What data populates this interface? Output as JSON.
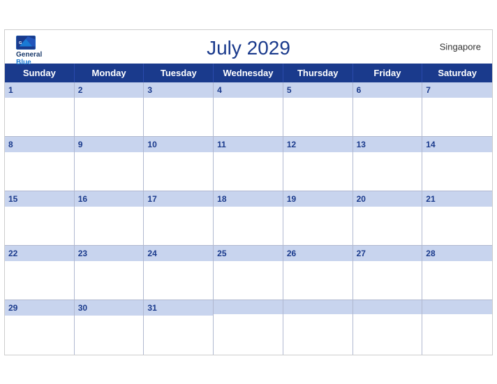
{
  "calendar": {
    "title": "July 2029",
    "country": "Singapore",
    "days_of_week": [
      "Sunday",
      "Monday",
      "Tuesday",
      "Wednesday",
      "Thursday",
      "Friday",
      "Saturday"
    ],
    "weeks": [
      [
        {
          "date": 1,
          "shaded": true
        },
        {
          "date": 2,
          "shaded": true
        },
        {
          "date": 3,
          "shaded": true
        },
        {
          "date": 4,
          "shaded": true
        },
        {
          "date": 5,
          "shaded": true
        },
        {
          "date": 6,
          "shaded": true
        },
        {
          "date": 7,
          "shaded": true
        }
      ],
      [
        {
          "date": 8,
          "shaded": true
        },
        {
          "date": 9,
          "shaded": true
        },
        {
          "date": 10,
          "shaded": true
        },
        {
          "date": 11,
          "shaded": true
        },
        {
          "date": 12,
          "shaded": true
        },
        {
          "date": 13,
          "shaded": true
        },
        {
          "date": 14,
          "shaded": true
        }
      ],
      [
        {
          "date": 15,
          "shaded": true
        },
        {
          "date": 16,
          "shaded": true
        },
        {
          "date": 17,
          "shaded": true
        },
        {
          "date": 18,
          "shaded": true
        },
        {
          "date": 19,
          "shaded": true
        },
        {
          "date": 20,
          "shaded": true
        },
        {
          "date": 21,
          "shaded": true
        }
      ],
      [
        {
          "date": 22,
          "shaded": true
        },
        {
          "date": 23,
          "shaded": true
        },
        {
          "date": 24,
          "shaded": true
        },
        {
          "date": 25,
          "shaded": true
        },
        {
          "date": 26,
          "shaded": true
        },
        {
          "date": 27,
          "shaded": true
        },
        {
          "date": 28,
          "shaded": true
        }
      ],
      [
        {
          "date": 29,
          "shaded": true
        },
        {
          "date": 30,
          "shaded": true
        },
        {
          "date": 31,
          "shaded": true
        },
        {
          "date": null,
          "shaded": true
        },
        {
          "date": null,
          "shaded": true
        },
        {
          "date": null,
          "shaded": true
        },
        {
          "date": null,
          "shaded": true
        }
      ]
    ],
    "logo": {
      "general": "General",
      "blue": "Blue"
    }
  }
}
